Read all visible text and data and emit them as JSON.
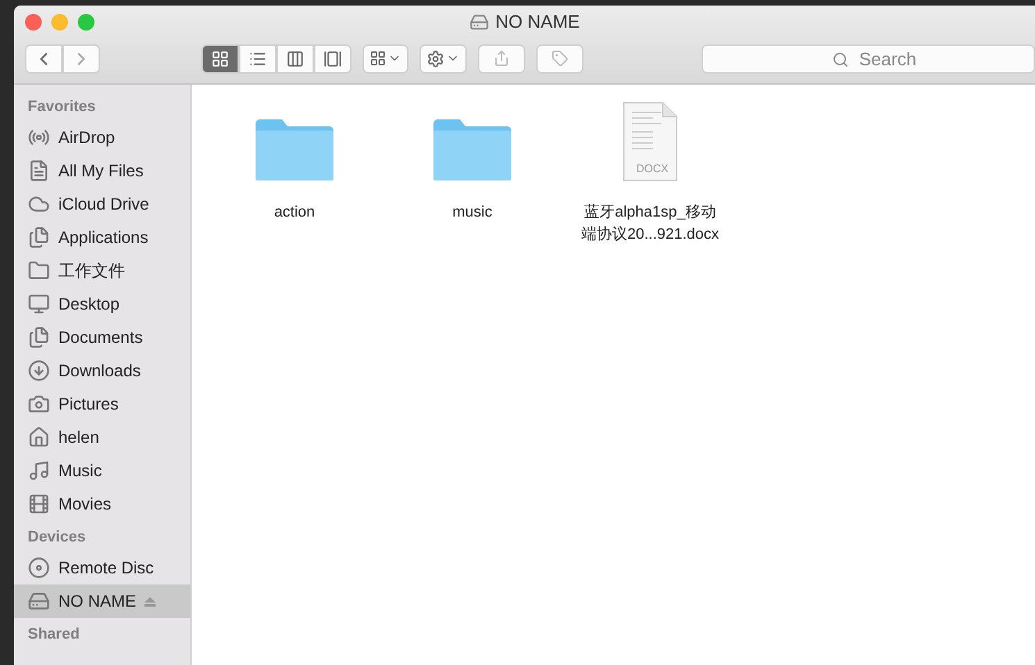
{
  "window": {
    "title": "NO NAME"
  },
  "toolbar": {
    "views": [
      {
        "kind": "icons",
        "selected": true
      },
      {
        "kind": "list",
        "selected": false
      },
      {
        "kind": "columns",
        "selected": false
      },
      {
        "kind": "cover",
        "selected": false
      }
    ],
    "search": {
      "placeholder": "Search"
    }
  },
  "sidebar": {
    "sections": [
      {
        "heading": "Favorites",
        "items": [
          {
            "kind": "airdrop",
            "label": "AirDrop",
            "selected": false
          },
          {
            "kind": "allfiles",
            "label": "All My Files",
            "selected": false
          },
          {
            "kind": "cloud",
            "label": "iCloud Drive",
            "selected": false
          },
          {
            "kind": "apps",
            "label": "Applications",
            "selected": false
          },
          {
            "kind": "folder",
            "label": "工作文件",
            "selected": false
          },
          {
            "kind": "desktop",
            "label": "Desktop",
            "selected": false
          },
          {
            "kind": "documents",
            "label": "Documents",
            "selected": false
          },
          {
            "kind": "downloads",
            "label": "Downloads",
            "selected": false
          },
          {
            "kind": "pictures",
            "label": "Pictures",
            "selected": false
          },
          {
            "kind": "home",
            "label": "helen",
            "selected": false
          },
          {
            "kind": "music",
            "label": "Music",
            "selected": false
          },
          {
            "kind": "movies",
            "label": "Movies",
            "selected": false
          }
        ]
      },
      {
        "heading": "Devices",
        "items": [
          {
            "kind": "disc",
            "label": "Remote Disc",
            "selected": false
          },
          {
            "kind": "drive",
            "label": "NO NAME",
            "selected": true,
            "ejectable": true
          }
        ]
      },
      {
        "heading": "Shared"
      }
    ]
  },
  "files": [
    {
      "kind": "folder",
      "name": "action"
    },
    {
      "kind": "folder",
      "name": "music"
    },
    {
      "kind": "document",
      "name": "蓝牙alpha1sp_移动端协议20...921.docx",
      "badge": "DOCX"
    }
  ]
}
